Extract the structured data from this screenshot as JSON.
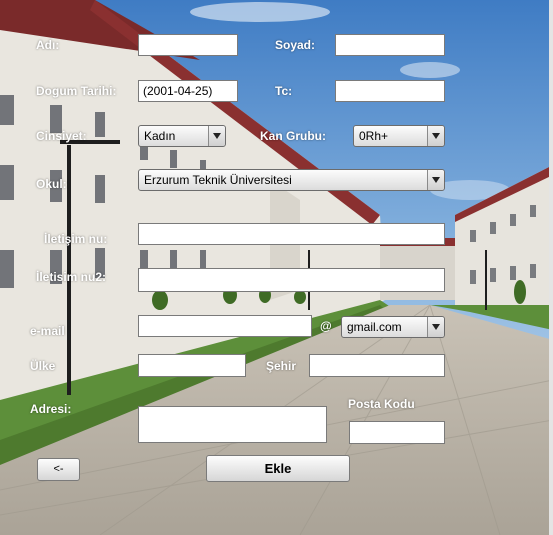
{
  "form": {
    "adi_label": "Adı:",
    "adi_value": "",
    "soyad_label": "Soyad:",
    "soyad_value": "",
    "dogum_label": "Dogum Tarihi:",
    "dogum_value": "(2001-04-25)",
    "tc_label": "Tc:",
    "tc_value": "",
    "cinsiyet_label": "Cinsiyet:",
    "cinsiyet_value": "Kadın",
    "kan_label": "Kan Grubu:",
    "kan_value": "0Rh+",
    "okul_label": "Okul:",
    "okul_value": "Erzurum Teknik Üniversitesi",
    "iletisim1_label": "İletişim nu:",
    "iletisim1_value": "",
    "iletisim2_label": "İletisim nu2:",
    "iletisim2_value": "",
    "email_label": "e-mail",
    "email_value": "",
    "at_sign": "@",
    "email_domain": "gmail.com",
    "ulke_label": "Ülke",
    "ulke_value": "",
    "sehir_label": "Şehir",
    "sehir_value": "",
    "adres_label": "Adresi:",
    "adres_value": "",
    "posta_label": "Posta Kodu",
    "posta_value": ""
  },
  "buttons": {
    "back": "<-",
    "add": "Ekle"
  }
}
